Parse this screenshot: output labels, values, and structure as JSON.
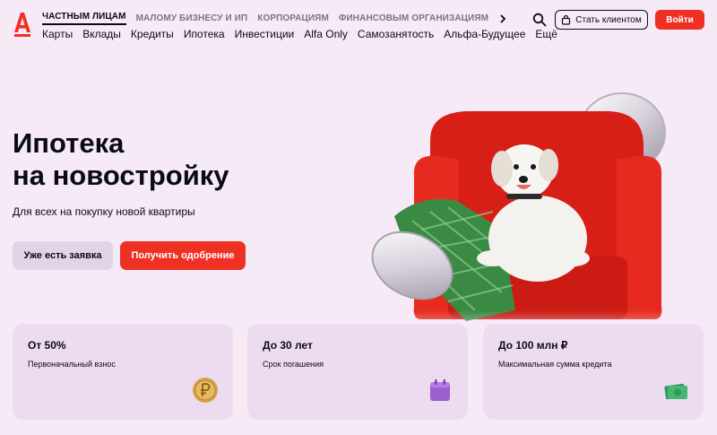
{
  "colors": {
    "brand_red": "#ef3124",
    "background": "#f6eaf7",
    "card_bg": "#eddcef"
  },
  "header": {
    "segments": [
      "ЧАСТНЫМ ЛИЦАМ",
      "МАЛОМУ БИЗНЕСУ И ИП",
      "КОРПОРАЦИЯМ",
      "ФИНАНСОВЫМ ОРГАНИЗАЦИЯМ"
    ],
    "menu": [
      "Карты",
      "Вклады",
      "Кредиты",
      "Ипотека",
      "Инвестиции",
      "Alfa Only",
      "Самозанятость",
      "Альфа-Будущее",
      "Ещё"
    ],
    "become_client_label": "Стать клиентом",
    "login_label": "Войти",
    "icons": [
      "alfa-logo",
      "chevron-right-icon",
      "search-icon",
      "bag-icon"
    ]
  },
  "hero": {
    "title_line1": "Ипотека",
    "title_line2": "на новостройку",
    "subtitle": "Для всех на покупку новой квартиры",
    "existing_button": "Уже есть заявка",
    "approve_button": "Получить одобрение"
  },
  "cards": [
    {
      "title": "От 50%",
      "subtitle": "Первоначальный взнос",
      "icon": "ruble-coin-icon"
    },
    {
      "title": "До 30 лет",
      "subtitle": "Срок погашения",
      "icon": "calendar-icon"
    },
    {
      "title": "До 100 млн ₽",
      "subtitle": "Максимальная сумма кредита",
      "icon": "banknotes-icon"
    }
  ]
}
